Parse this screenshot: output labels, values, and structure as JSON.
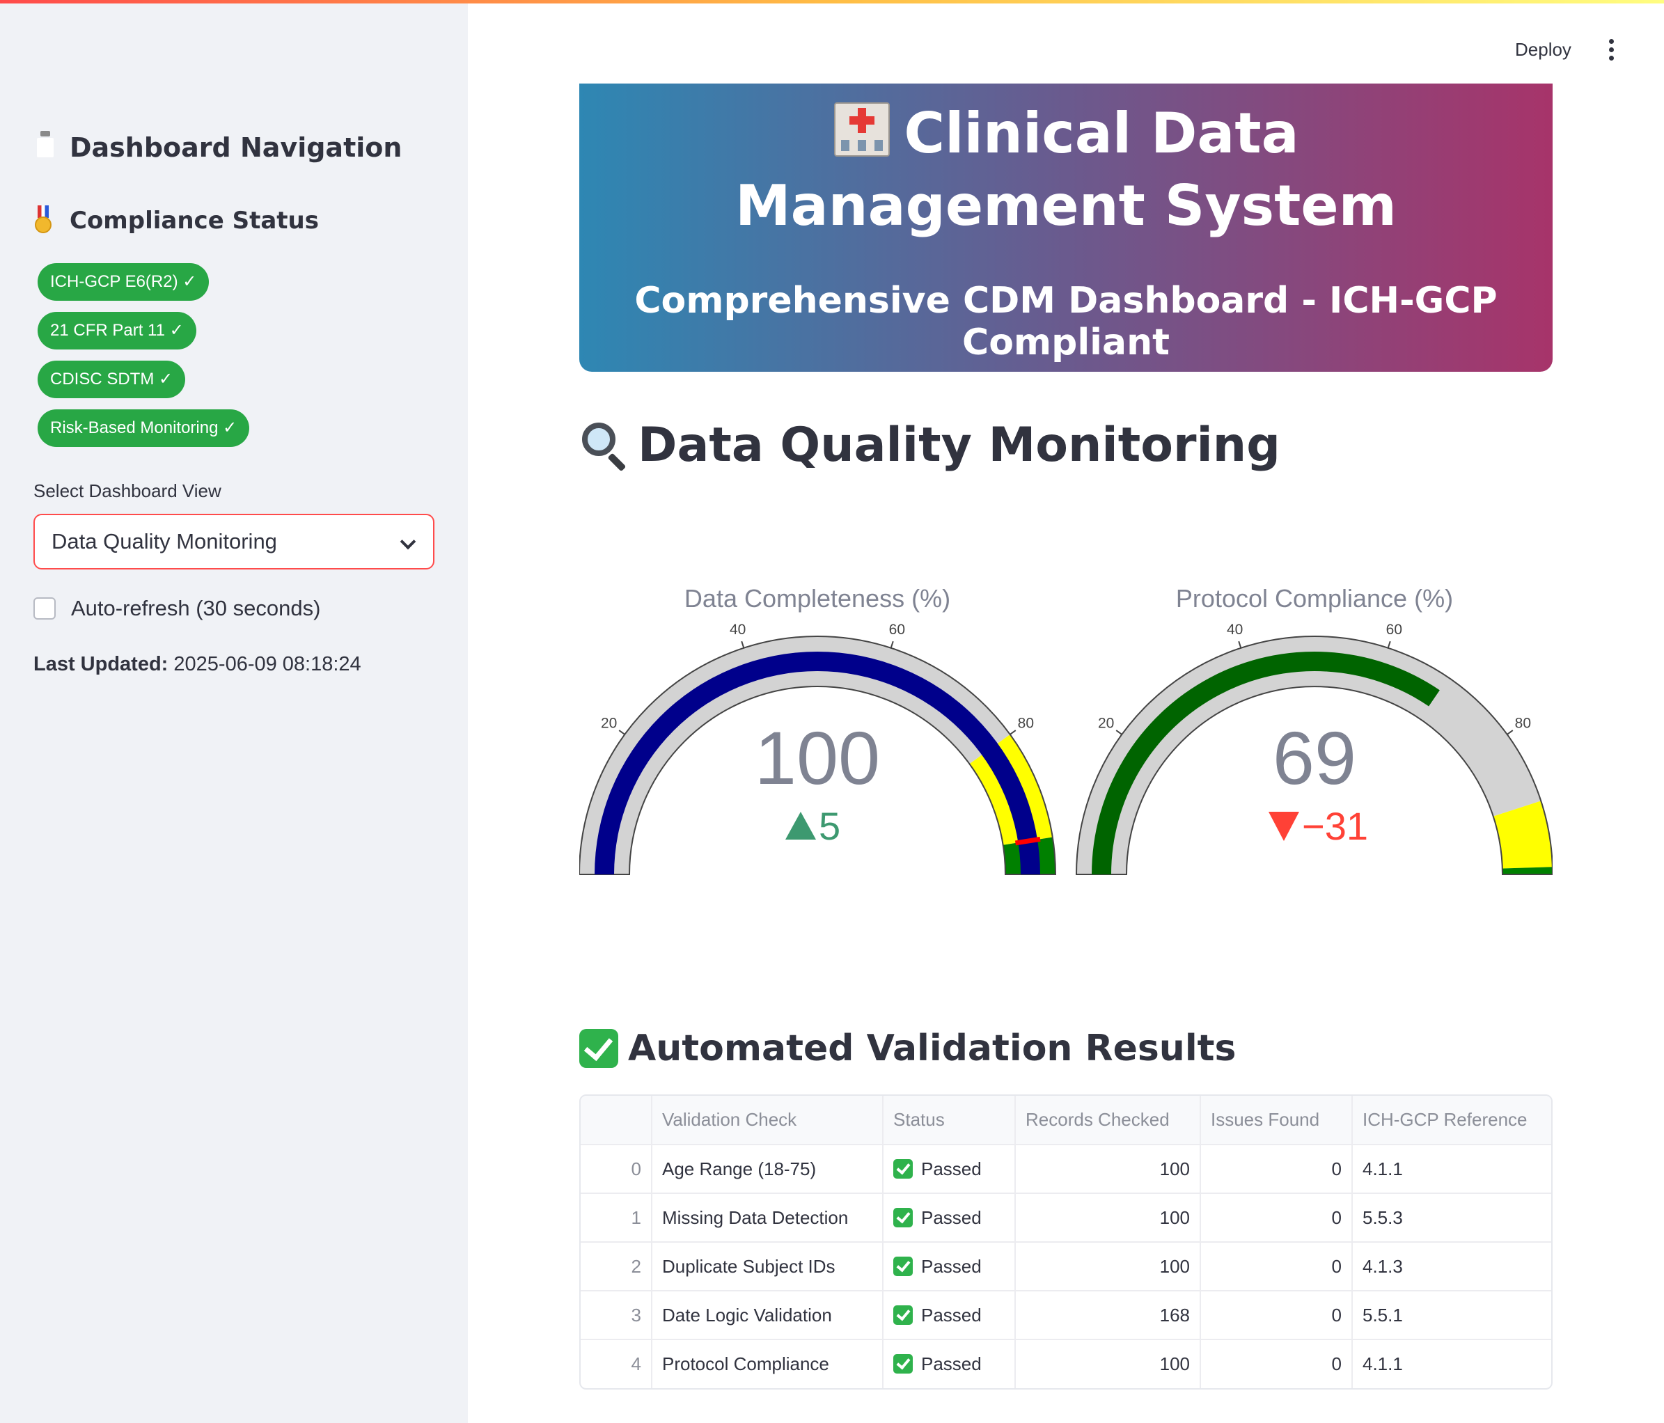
{
  "toolbar": {
    "deploy_label": "Deploy",
    "menu_icon": "kebab-menu-icon"
  },
  "sidebar": {
    "nav_title": "Dashboard Navigation",
    "nav_icon": "clipboard-icon",
    "compliance_title": "Compliance Status",
    "compliance_icon": "medal-icon",
    "badges": [
      "ICH-GCP E6(R2) ✓",
      "21 CFR Part 11 ✓",
      "CDISC SDTM ✓",
      "Risk-Based Monitoring ✓"
    ],
    "badge_color": "#28a745",
    "select_label": "Select Dashboard View",
    "select_value": "Data Quality Monitoring",
    "autorefresh_label": "Auto-refresh (30 seconds)",
    "autorefresh_checked": false,
    "last_updated_label": "Last Updated:",
    "last_updated_value": "2025-06-09 08:18:24"
  },
  "hero": {
    "icon": "hospital-icon",
    "title": "Clinical Data Management System",
    "subtitle": "Comprehensive CDM Dashboard - ICH-GCP Compliant",
    "gradient": [
      "#2e87b3",
      "#a7346a"
    ]
  },
  "sections": {
    "data_quality": {
      "title": "Data Quality Monitoring",
      "icon": "magnifier-icon"
    },
    "validation": {
      "title": "Automated Validation Results",
      "icon": "check-mark-icon"
    }
  },
  "chart_data": [
    {
      "type": "gauge",
      "title": "Data Completeness (%)",
      "value": 100,
      "delta": "5",
      "delta_direction": "up",
      "range": [
        0,
        100
      ],
      "ticks": [
        20,
        40,
        60,
        80
      ],
      "bar_color": "#00008b",
      "steps": [
        {
          "range": [
            0,
            80
          ],
          "color": "#d3d3d3"
        },
        {
          "range": [
            80,
            95
          ],
          "color": "#ffff00"
        },
        {
          "range": [
            95,
            100
          ],
          "color": "#008000"
        }
      ],
      "threshold": 95,
      "threshold_color": "#ff0000",
      "delta_up_color": "#3d9970",
      "delta_down_color": "#ff4136"
    },
    {
      "type": "gauge",
      "title": "Protocol Compliance (%)",
      "value": 69,
      "delta": "−31",
      "delta_direction": "down",
      "range": [
        0,
        100
      ],
      "ticks": [
        20,
        40,
        60,
        80
      ],
      "bar_color": "#006400",
      "steps": [
        {
          "range": [
            0,
            90
          ],
          "color": "#d3d3d3"
        },
        {
          "range": [
            90,
            99
          ],
          "color": "#ffff00"
        },
        {
          "range": [
            99,
            100
          ],
          "color": "#008000"
        }
      ],
      "threshold": null,
      "delta_up_color": "#3d9970",
      "delta_down_color": "#ff4136"
    }
  ],
  "table": {
    "columns": [
      "",
      "Validation Check",
      "Status",
      "Records Checked",
      "Issues Found",
      "ICH-GCP Reference"
    ],
    "rows": [
      [
        "0",
        "Age Range (18-75)",
        "Passed",
        "100",
        "0",
        "4.1.1"
      ],
      [
        "1",
        "Missing Data Detection",
        "Passed",
        "100",
        "0",
        "5.5.3"
      ],
      [
        "2",
        "Duplicate Subject IDs",
        "Passed",
        "100",
        "0",
        "4.1.3"
      ],
      [
        "3",
        "Date Logic Validation",
        "Passed",
        "168",
        "0",
        "5.5.1"
      ],
      [
        "4",
        "Protocol Compliance",
        "Passed",
        "100",
        "0",
        "4.1.1"
      ]
    ],
    "status_icon": "check-mark-icon"
  }
}
